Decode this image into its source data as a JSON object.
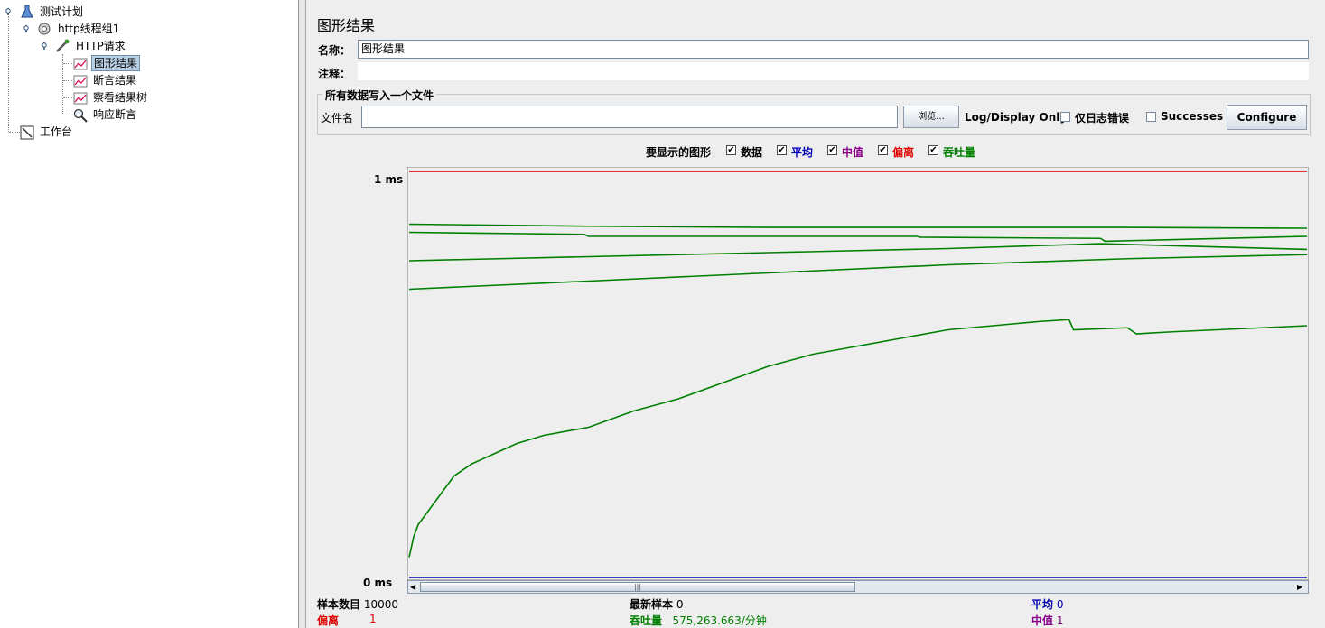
{
  "tree": {
    "test_plan": "测试计划",
    "thread_group": "http线程组1",
    "http_request": "HTTP请求",
    "graph_results": "图形结果",
    "assertion_results": "断言结果",
    "view_results_tree": "察看结果树",
    "response_assertion": "响应断言",
    "workbench": "工作台"
  },
  "panel": {
    "title": "图形结果",
    "name_label": "名称：",
    "name_value": "图形结果",
    "comment_label": "注释：",
    "comment_value": ""
  },
  "file_section": {
    "legend": "所有数据写入一个文件",
    "filename_label": "文件名",
    "filename_value": "",
    "browse_label": "浏览...",
    "log_display_only": "Log/Display Only:",
    "errors_only_label": "仅日志错误",
    "errors_only_checked": false,
    "successes_label": "Successes",
    "successes_checked": false,
    "configure_label": "Configure"
  },
  "graphs_to_display": {
    "label": "要显示的图形",
    "options": [
      {
        "label": "数据",
        "checked": true,
        "color": "#000000"
      },
      {
        "label": "平均",
        "checked": true,
        "color": "#0000b4"
      },
      {
        "label": "中值",
        "checked": true,
        "color": "#8a008a"
      },
      {
        "label": "偏离",
        "checked": true,
        "color": "#e00000"
      },
      {
        "label": "吞吐量",
        "checked": true,
        "color": "#008000"
      }
    ]
  },
  "chart_data": {
    "type": "line",
    "y_top_label": "1 ms",
    "y_bottom_label": "0 ms",
    "ylim": [
      0,
      1
    ],
    "x_range": [
      0,
      10000
    ],
    "series": [
      {
        "name": "偏离",
        "color": "#e00000",
        "x": [
          0,
          10000
        ],
        "y": [
          1.0,
          1.0
        ]
      },
      {
        "name": "平均",
        "color": "#0000b4",
        "x": [
          0,
          10000
        ],
        "y": [
          0.0,
          0.0
        ]
      },
      {
        "name": "吞吐量",
        "color": "#008000",
        "x": [
          0,
          2000,
          4000,
          6000,
          8000,
          10000
        ],
        "y": [
          0.87,
          0.865,
          0.862,
          0.862,
          0.862,
          0.86
        ]
      },
      {
        "name": "吞吐量",
        "color": "#008000",
        "x": [
          0,
          1950,
          2000,
          5650,
          5700,
          7700,
          7750,
          10000
        ],
        "y": [
          0.85,
          0.845,
          0.84,
          0.84,
          0.838,
          0.835,
          0.828,
          0.84
        ]
      },
      {
        "name": "吞吐量",
        "color": "#008000",
        "x": [
          0,
          2000,
          4000,
          6000,
          7700,
          10000
        ],
        "y": [
          0.78,
          0.79,
          0.8,
          0.81,
          0.822,
          0.808
        ]
      },
      {
        "name": "吞吐量",
        "color": "#008000",
        "x": [
          0,
          2000,
          4000,
          6000,
          8000,
          10000
        ],
        "y": [
          0.71,
          0.73,
          0.75,
          0.77,
          0.785,
          0.795
        ]
      },
      {
        "name": "吞吐量",
        "color": "#008000",
        "x": [
          0,
          50,
          100,
          200,
          400,
          500,
          700,
          1000,
          1200,
          1500,
          2000,
          2500,
          3000,
          3500,
          4000,
          4500,
          5000,
          5500,
          6000,
          6500,
          7000,
          7350,
          7400,
          8000,
          8100,
          8500,
          9000,
          9500,
          10000
        ],
        "y": [
          0.05,
          0.1,
          0.13,
          0.16,
          0.22,
          0.25,
          0.28,
          0.31,
          0.33,
          0.35,
          0.37,
          0.41,
          0.44,
          0.48,
          0.52,
          0.55,
          0.57,
          0.59,
          0.61,
          0.62,
          0.63,
          0.635,
          0.61,
          0.615,
          0.6,
          0.605,
          0.61,
          0.615,
          0.62
        ]
      }
    ]
  },
  "stats": {
    "sample_count_label": "样本数目",
    "sample_count": "10000",
    "latest_sample_label": "最新样本",
    "latest_sample": "0",
    "average_label": "平均",
    "average": "0",
    "deviation_label": "偏离",
    "deviation": "1",
    "throughput_label": "吞吐量",
    "throughput": "575,263.663/分钟",
    "median_label": "中值",
    "median": "1"
  }
}
